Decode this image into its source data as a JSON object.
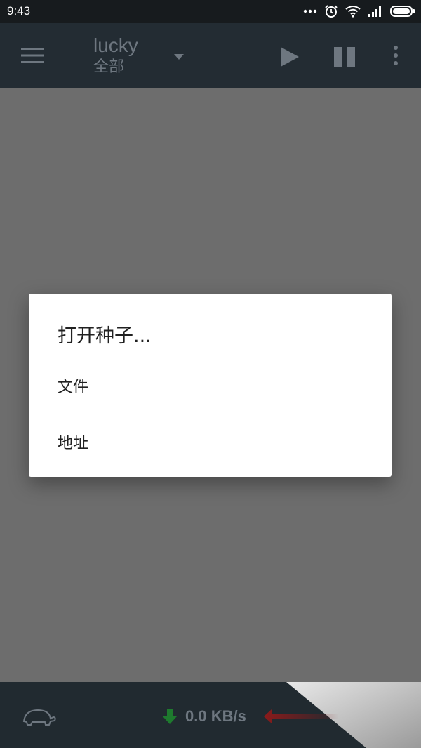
{
  "status_bar": {
    "time": "9:43",
    "icons": [
      "more-dots-icon",
      "alarm-icon",
      "wifi-icon",
      "signal-icon",
      "battery-icon"
    ]
  },
  "app_bar": {
    "title": "lucky",
    "subtitle": "全部",
    "icons": [
      "menu-icon",
      "dropdown-icon",
      "play-icon",
      "pause-icon",
      "more-vertical-icon"
    ]
  },
  "dialog": {
    "title": "打开种子...",
    "items": [
      "文件",
      "地址"
    ]
  },
  "bottom_bar": {
    "speed": "0.0 KB/s",
    "icons": [
      "turtle-icon",
      "download-arrow-icon",
      "upload-arrow-icon"
    ]
  },
  "colors": {
    "status_bar": "#171b1e",
    "app_bar": "#232c33",
    "overlay": "#6d6d6d",
    "dialog": "#ffffff",
    "download": "#1e7a2e",
    "upload": "#8b1a1a"
  }
}
